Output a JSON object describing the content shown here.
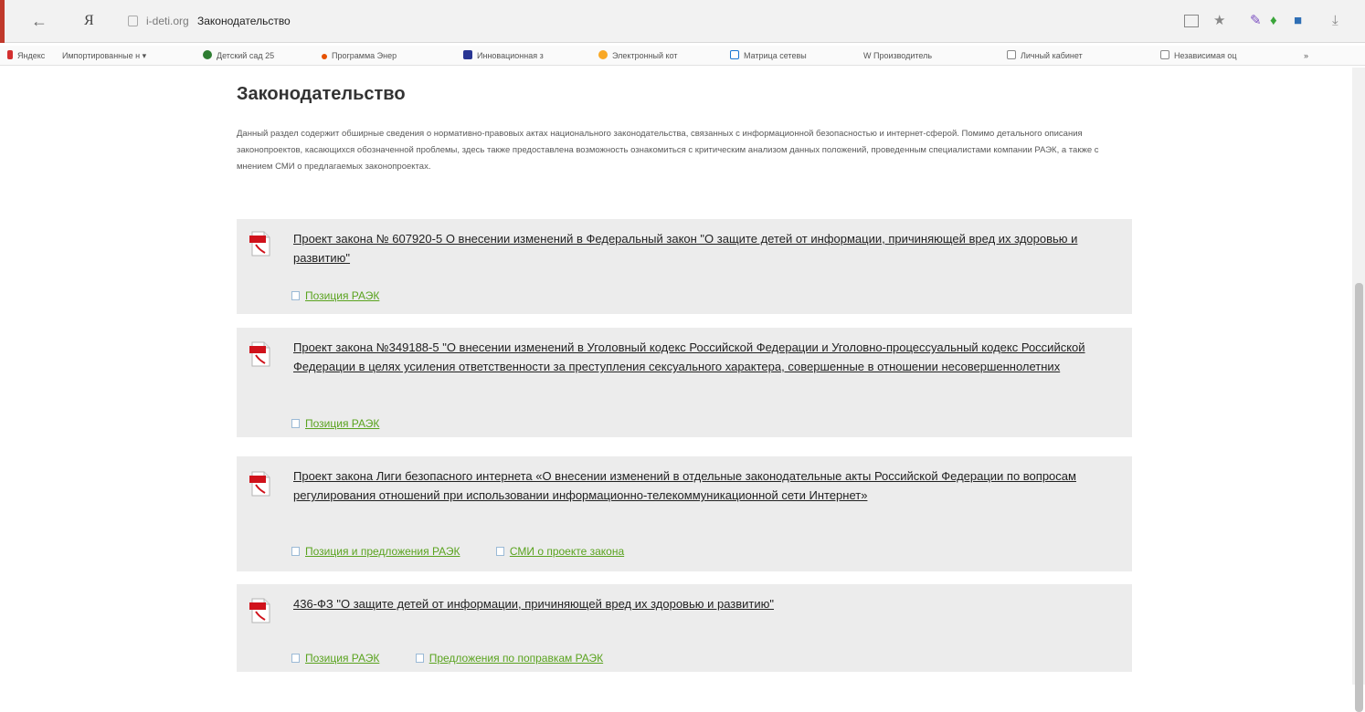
{
  "browser": {
    "url_domain": "i-deti.org",
    "page_tab_title": "Законодательство",
    "ya_logo": "Я",
    "bookmarks": [
      {
        "label": "Яндекс",
        "color": "#d32f2f"
      },
      {
        "label": "Импортированные н",
        "color": "#9e9e9e"
      },
      {
        "label": "Детский сад 25",
        "color": "#2e7d32"
      },
      {
        "label": "Программа Энер",
        "color": "#e65100"
      },
      {
        "label": "Инновационная з",
        "color": "#283593"
      },
      {
        "label": "Электронный кот",
        "color": "#f9a825"
      },
      {
        "label": "Матрица сетевы",
        "color": "#1976d2"
      },
      {
        "label": "W  Производитель",
        "color": "#ffffff"
      },
      {
        "label": "Личный кабинет",
        "color": "#ffffff"
      },
      {
        "label": "Независимая оц",
        "color": "#ffffff"
      }
    ],
    "more_bookmarks": "»",
    "extension_icons": [
      "reader-icon",
      "star-icon",
      "pen-icon",
      "leaf-icon",
      "bag-icon",
      "download-icon"
    ]
  },
  "page": {
    "title": "Законодательство",
    "intro": "Данный раздел содержит обширные сведения о нормативно-правовых актах национального законодательства, связанных с информационной безопасностью и интернет-сферой. Помимо детального описания законопроектов, касающихся обозначенной проблемы, здесь также предоставлена возможность ознакомиться с критическим анализом данных положений, проведенным специалистами компании РАЭК, а также с мнением СМИ о предлагаемых законопроектах.",
    "items": [
      {
        "title": "Проект закона № 607920-5 О внесении изменений в Федеральный закон \"О защите детей от информации, причиняющей вред их здоровью и развитию\"",
        "links": [
          "Позиция РАЭК"
        ]
      },
      {
        "title": "Проект закона №349188-5 \"О внесении изменений в Уголовный кодекс Российской Федерации и Уголовно-процессуальный кодекс Российской Федерации в целях усиления ответственности за преступления сексуального характера, совершенные в отношении несовершеннолетних",
        "links": [
          "Позиция РАЭК"
        ]
      },
      {
        "title": "Проект закона Лиги безопасного интернета «О внесении изменений в отдельные законодательные акты Российской Федерации по вопросам регулирования отношений при использовании информационно-телекоммуникационной сети Интернет»",
        "links": [
          "Позиция и предложения РАЭК",
          "СМИ о проекте закона"
        ]
      },
      {
        "title": "436-ФЗ \"О защите детей от информации, причиняющей вред их здоровью и развитию\"",
        "links": [
          "Позиция РАЭК",
          "Предложения по поправкам РАЭК"
        ]
      }
    ]
  },
  "colors": {
    "card_bg": "#ececec",
    "link_green": "#5aa31f",
    "pdf_red": "#d0121b"
  }
}
